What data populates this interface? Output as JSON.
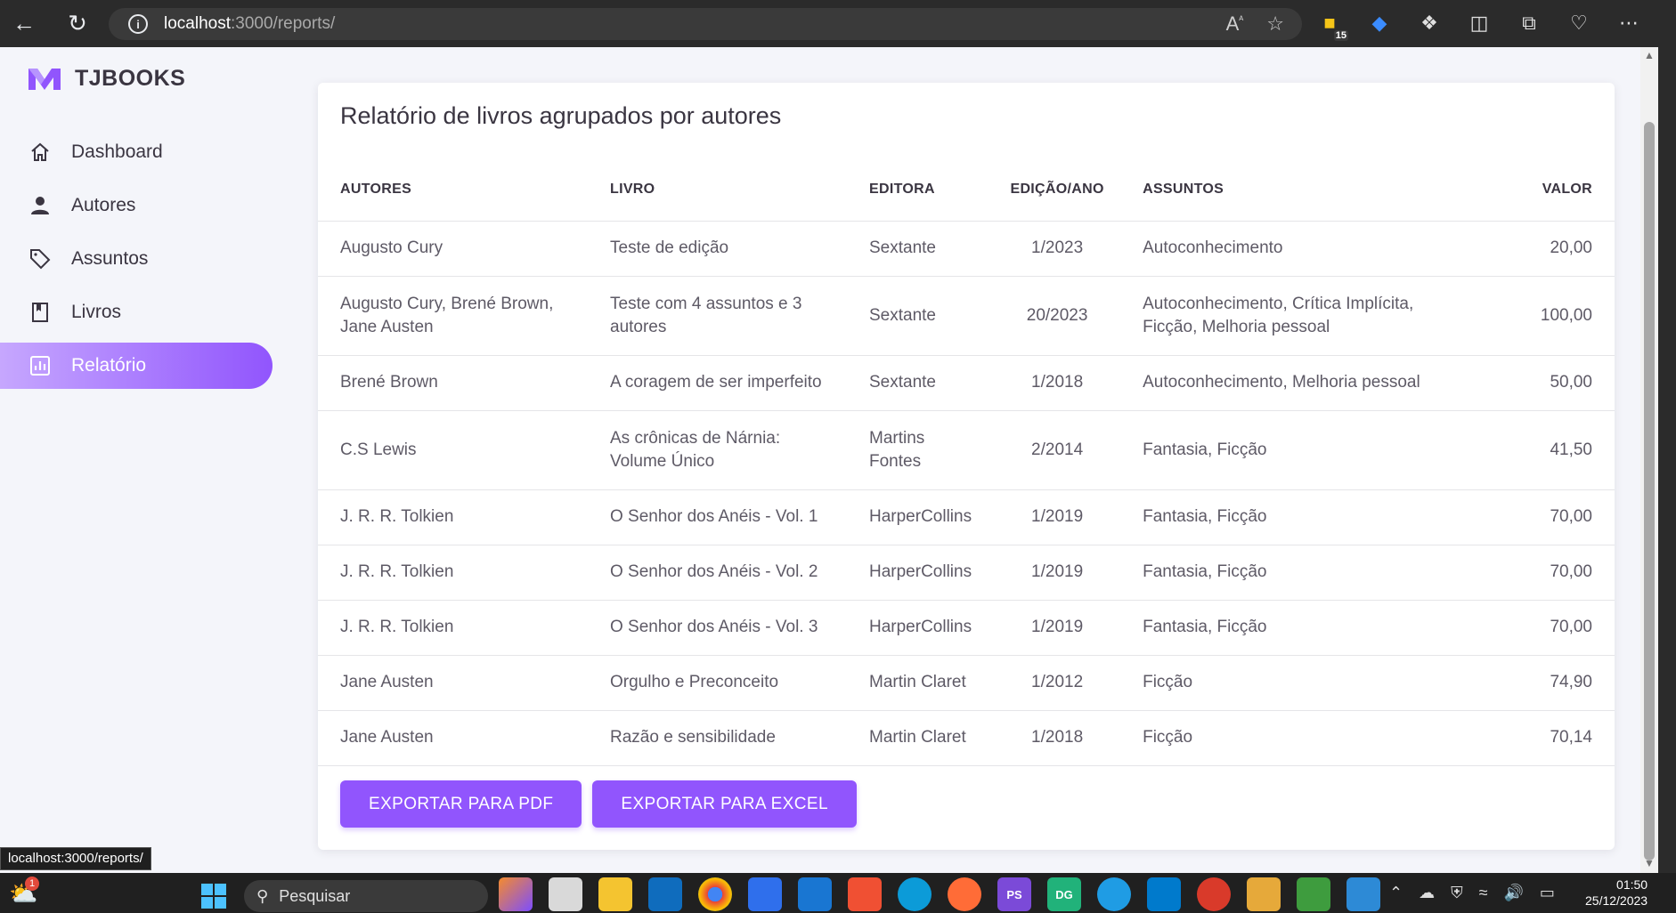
{
  "browser": {
    "url_host": "localhost",
    "url_path": ":3000/reports/",
    "extension_badge": "15"
  },
  "brand": {
    "name": "TJBOOKS",
    "accent": "#9155fd"
  },
  "sidebar": {
    "items": [
      {
        "label": "Dashboard",
        "icon": "home-icon"
      },
      {
        "label": "Autores",
        "icon": "user-icon"
      },
      {
        "label": "Assuntos",
        "icon": "tag-icon"
      },
      {
        "label": "Livros",
        "icon": "book-icon"
      },
      {
        "label": "Relatório",
        "icon": "report-chart-icon",
        "active": true
      }
    ]
  },
  "report": {
    "title": "Relatório de livros agrupados por autores",
    "columns": [
      "AUTORES",
      "LIVRO",
      "EDITORA",
      "EDIÇÃO/ANO",
      "ASSUNTOS",
      "VALOR"
    ],
    "rows": [
      {
        "autores": "Augusto Cury",
        "livro": "Teste de edição",
        "editora": "Sextante",
        "edicao": "1/2023",
        "assuntos": "Autoconhecimento",
        "valor": "20,00"
      },
      {
        "autores": "Augusto Cury, Brené Brown, Jane Austen",
        "livro": "Teste com 4 assuntos e 3 autores",
        "editora": "Sextante",
        "edicao": "20/2023",
        "assuntos": "Autoconhecimento, Crítica Implícita, Ficção, Melhoria pessoal",
        "valor": "100,00"
      },
      {
        "autores": "Brené Brown",
        "livro": "A coragem de ser imperfeito",
        "editora": "Sextante",
        "edicao": "1/2018",
        "assuntos": "Autoconhecimento, Melhoria pessoal",
        "valor": "50,00"
      },
      {
        "autores": "C.S Lewis",
        "livro": "As crônicas de Nárnia: Volume Único",
        "editora": "Martins Fontes",
        "edicao": "2/2014",
        "assuntos": "Fantasia, Ficção",
        "valor": "41,50"
      },
      {
        "autores": "J. R. R. Tolkien",
        "livro": "O Senhor dos Anéis - Vol. 1",
        "editora": "HarperCollins",
        "edicao": "1/2019",
        "assuntos": "Fantasia, Ficção",
        "valor": "70,00"
      },
      {
        "autores": "J. R. R. Tolkien",
        "livro": "O Senhor dos Anéis - Vol. 2",
        "editora": "HarperCollins",
        "edicao": "1/2019",
        "assuntos": "Fantasia, Ficção",
        "valor": "70,00"
      },
      {
        "autores": "J. R. R. Tolkien",
        "livro": "O Senhor dos Anéis - Vol. 3",
        "editora": "HarperCollins",
        "edicao": "1/2019",
        "assuntos": "Fantasia, Ficção",
        "valor": "70,00"
      },
      {
        "autores": "Jane Austen",
        "livro": "Orgulho e Preconceito",
        "editora": "Martin Claret",
        "edicao": "1/2012",
        "assuntos": "Ficção",
        "valor": "74,90"
      },
      {
        "autores": "Jane Austen",
        "livro": "Razão e sensibilidade",
        "editora": "Martin Claret",
        "edicao": "1/2018",
        "assuntos": "Ficção",
        "valor": "70,14"
      }
    ],
    "export_pdf_label": "EXPORTAR PARA PDF",
    "export_excel_label": "EXPORTAR PARA EXCEL"
  },
  "status_bar_url": "localhost:3000/reports/",
  "taskbar": {
    "search_placeholder": "Pesquisar",
    "weather_badge": "1",
    "time": "01:50",
    "date": "25/12/2023"
  }
}
